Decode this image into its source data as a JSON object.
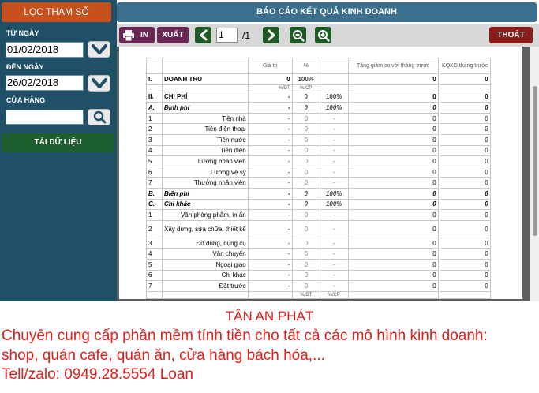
{
  "sidebar": {
    "filter_title": "LỌC  THAM SỐ",
    "from_label": "TỪ NGÀY",
    "from_value": "01/02/2018",
    "to_label": "ĐẾN NGÀY",
    "to_value": "26/02/2018",
    "store_label": "CỬA HÀNG",
    "store_value": "",
    "load_button": "TẢI DỮ LIỆU"
  },
  "header": {
    "title": "BÁO CÁO KẾT QUẢ KINH DOANH"
  },
  "toolbar": {
    "print_label": "IN",
    "export_label": "XUẤT",
    "page_value": "1",
    "page_total": "/1",
    "exit_label": "THOÁT"
  },
  "report": {
    "columns": {
      "value": "Giá trị",
      "percent": "%",
      "change": "Tăng giảm so với tháng trước",
      "prev": "KQKD tháng trước"
    },
    "subheaders": {
      "dt": "%/DT",
      "cp": "%/CP"
    },
    "rows": [
      {
        "type": "bold",
        "no": "I.",
        "name": "DOANH THU",
        "value": "0",
        "pct": "100%",
        "pct2": "",
        "change": "0",
        "prev": "0"
      },
      {
        "type": "sub",
        "no": "",
        "name": "",
        "value": "%/DT",
        "pct": "%/CP",
        "pct2": "",
        "change": "",
        "prev": ""
      },
      {
        "type": "bold",
        "no": "II.",
        "name": "CHI PHÍ",
        "value": "-",
        "pct": "0",
        "pct2": "100%",
        "change": "0",
        "prev": "0"
      },
      {
        "type": "group",
        "no": "A.",
        "name": "Định phí",
        "value": "-",
        "pct": "0",
        "pct2": "100%",
        "change": "0",
        "prev": "0"
      },
      {
        "type": "item",
        "no": "1",
        "name": "Tiền nhà",
        "value": "-",
        "pct": "0",
        "pct2": "-",
        "change": "0",
        "prev": "0"
      },
      {
        "type": "item",
        "no": "2",
        "name": "Tiền điện thoại",
        "value": "-",
        "pct": "0",
        "pct2": "-",
        "change": "0",
        "prev": "0"
      },
      {
        "type": "item",
        "no": "3",
        "name": "Tiền nước",
        "value": "-",
        "pct": "0",
        "pct2": "-",
        "change": "0",
        "prev": "0"
      },
      {
        "type": "item",
        "no": "4",
        "name": "Tiền điện",
        "value": "-",
        "pct": "0",
        "pct2": "-",
        "change": "0",
        "prev": "0"
      },
      {
        "type": "item",
        "no": "5",
        "name": "Lương nhân viên",
        "value": "-",
        "pct": "0",
        "pct2": "-",
        "change": "0",
        "prev": "0"
      },
      {
        "type": "item",
        "no": "6",
        "name": "Lương vệ sỹ",
        "value": "-",
        "pct": "0",
        "pct2": "-",
        "change": "0",
        "prev": "0"
      },
      {
        "type": "item",
        "no": "7",
        "name": "Thưởng nhân viên",
        "value": "-",
        "pct": "0",
        "pct2": "-",
        "change": "0",
        "prev": "0"
      },
      {
        "type": "group",
        "no": "B.",
        "name": "Biến phí",
        "value": "-",
        "pct": "0",
        "pct2": "100%",
        "change": "0",
        "prev": "0"
      },
      {
        "type": "group",
        "no": "C.",
        "name": "Chi khác",
        "value": "-",
        "pct": "0",
        "pct2": "100%",
        "change": "0",
        "prev": "0"
      },
      {
        "type": "item",
        "no": "1",
        "name": "Văn phòng phẩm, in ấn",
        "value": "-",
        "pct": "0",
        "pct2": "-",
        "change": "0",
        "prev": "0"
      },
      {
        "type": "tall",
        "no": "2",
        "name": "Xây dựng, sửa chữa, thiết kế",
        "value": "-",
        "pct": "0",
        "pct2": "-",
        "change": "0",
        "prev": "0"
      },
      {
        "type": "item",
        "no": "3",
        "name": "Đồ dùng, dụng cụ",
        "value": "-",
        "pct": "0",
        "pct2": "-",
        "change": "0",
        "prev": "0"
      },
      {
        "type": "item",
        "no": "4",
        "name": "Vận chuyển",
        "value": "-",
        "pct": "0",
        "pct2": "-",
        "change": "0",
        "prev": "0"
      },
      {
        "type": "item",
        "no": "5",
        "name": "Ngoại giao",
        "value": "-",
        "pct": "0",
        "pct2": "-",
        "change": "0",
        "prev": "0"
      },
      {
        "type": "item",
        "no": "6",
        "name": "Chi khác",
        "value": "-",
        "pct": "0",
        "pct2": "-",
        "change": "0",
        "prev": "0"
      },
      {
        "type": "item",
        "no": "7",
        "name": "Đặt trước",
        "value": "-",
        "pct": "0",
        "pct2": "-",
        "change": "0",
        "prev": "0"
      },
      {
        "type": "sub",
        "no": "",
        "name": "",
        "value": "",
        "pct": "%/DT",
        "pct2": "%/CP",
        "change": "",
        "prev": ""
      }
    ]
  },
  "footer": {
    "brand": "TÂN AN PHÁT",
    "line1": "Chuyên cung cấp phần mềm tính tiền cho tất cả các mô hình kinh doanh:",
    "line2": "shop, quán cafe, quán ăn, cửa hàng bách hóa,...",
    "line3": "Tell/zalo: 0949.28.5554 Loan"
  },
  "colors": {
    "sidebar_bg": "#1f5068",
    "filter_title": "#c8501a",
    "header_bg": "#3b6f8e",
    "toolbar_button": "#6a2754",
    "nav_button": "#1f5a24",
    "exit_button": "#8a1c1c",
    "load_button": "#1d5e2e",
    "footer_text": "#e0201b"
  },
  "icons": [
    "printer-icon",
    "chevron-left-icon",
    "chevron-right-icon",
    "zoom-out-icon",
    "zoom-in-icon",
    "chevron-down-icon",
    "search-icon"
  ]
}
